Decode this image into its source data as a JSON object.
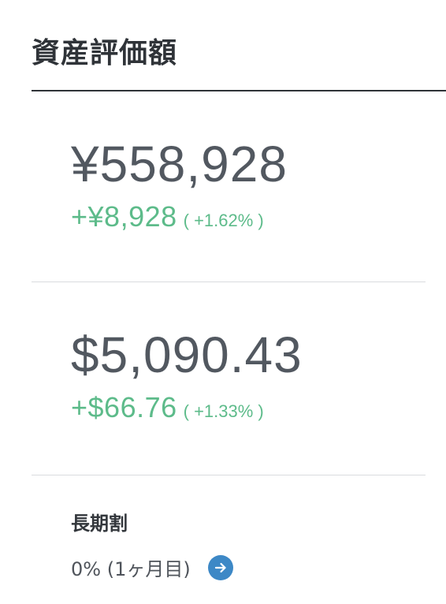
{
  "header": {
    "title": "資産評価額"
  },
  "jpy": {
    "value": "¥558,928",
    "change_amount": "+¥8,928",
    "change_percent": "( +1.62% )"
  },
  "usd": {
    "value": "$5,090.43",
    "change_amount": "+$66.76",
    "change_percent": "( +1.33% )"
  },
  "long_term_discount": {
    "heading": "長期割",
    "value": "0% (1ヶ月目)",
    "action_icon": "arrow-right-icon"
  },
  "colors": {
    "positive": "#5dbb8a",
    "accent": "#3d88c6",
    "text": "#525860"
  }
}
